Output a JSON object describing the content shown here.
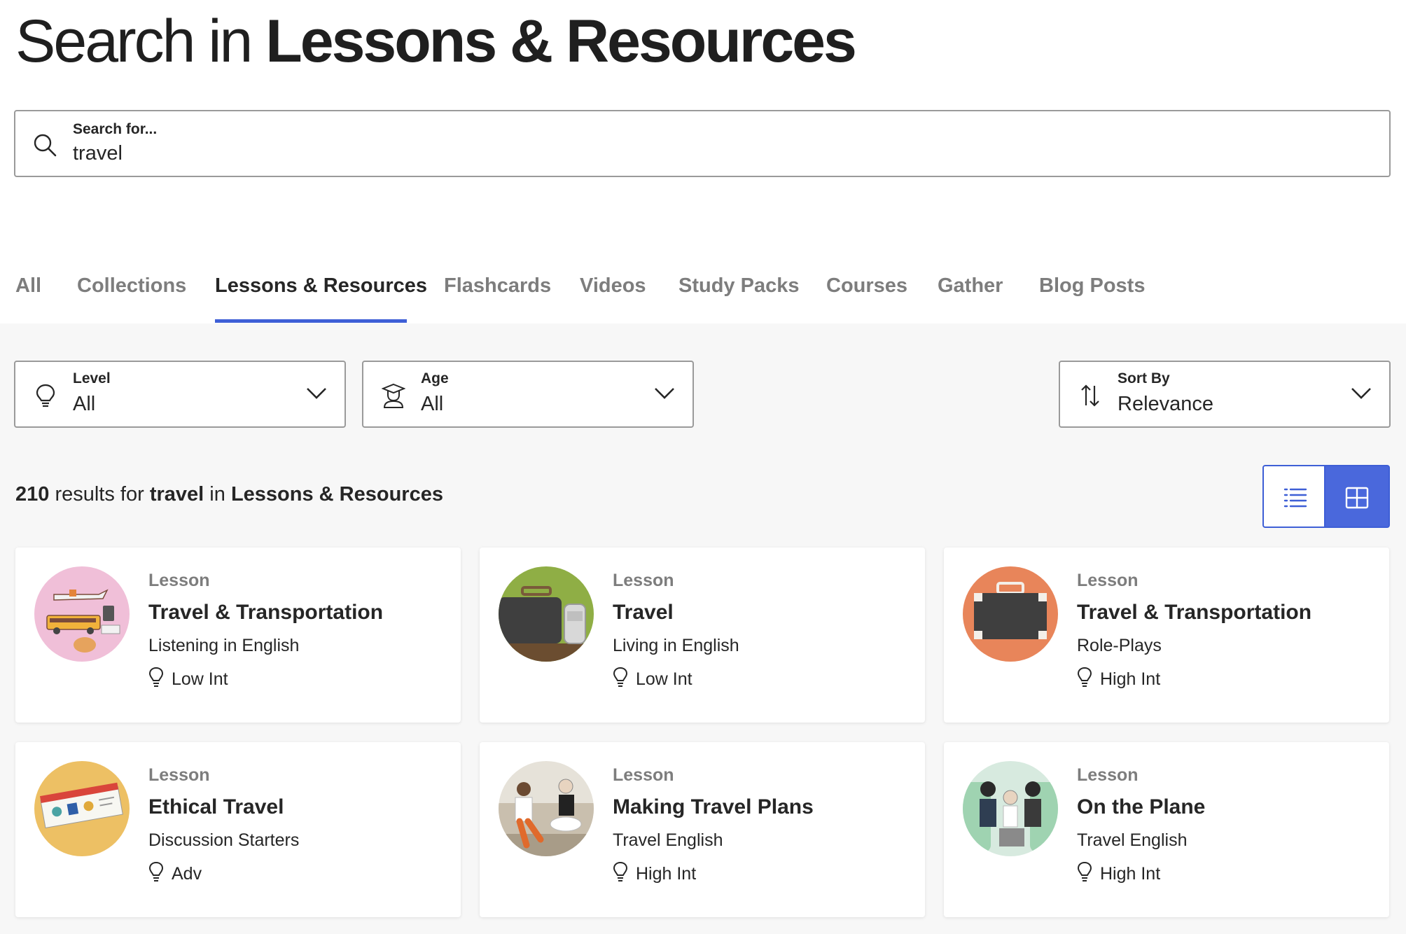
{
  "page_title": {
    "prefix": "Search in",
    "emphasis": "Lessons & Resources"
  },
  "search": {
    "label": "Search for...",
    "value": "travel",
    "icon": "search-icon"
  },
  "tabs": [
    {
      "label": "All",
      "active": false
    },
    {
      "label": "Collections",
      "active": false
    },
    {
      "label": "Lessons & Resources",
      "active": true
    },
    {
      "label": "Flashcards",
      "active": false
    },
    {
      "label": "Videos",
      "active": false
    },
    {
      "label": "Study Packs",
      "active": false
    },
    {
      "label": "Courses",
      "active": false
    },
    {
      "label": "Gather",
      "active": false
    },
    {
      "label": "Blog Posts",
      "active": false
    }
  ],
  "filters": {
    "level": {
      "label": "Level",
      "value": "All",
      "icon": "lightbulb-icon"
    },
    "age": {
      "label": "Age",
      "value": "All",
      "icon": "student-icon"
    },
    "sort": {
      "label": "Sort By",
      "value": "Relevance",
      "icon": "sort-arrows-icon"
    }
  },
  "results": {
    "count": "210",
    "text_results_for": "results for",
    "query": "travel",
    "text_in": "in",
    "section": "Lessons & Resources"
  },
  "view_toggle": {
    "active": "grid",
    "list_icon": "list-view-icon",
    "grid_icon": "grid-view-icon"
  },
  "colors": {
    "accent": "#3e5fd6",
    "accent_fill": "#4a68dc",
    "background": "#f7f7f7"
  },
  "cards": [
    {
      "type": "Lesson",
      "title": "Travel & Transportation",
      "subtitle": "Listening in English",
      "level": "Low Int",
      "thumb_bg": "#f0bfd8",
      "thumb": "vehicles-illustration"
    },
    {
      "type": "Lesson",
      "title": "Travel",
      "subtitle": "Living in English",
      "level": "Low Int",
      "thumb_bg": "#8fae45",
      "thumb": "suitcase-illustration"
    },
    {
      "type": "Lesson",
      "title": "Travel & Transportation",
      "subtitle": "Role-Plays",
      "level": "High Int",
      "thumb_bg": "#e8855a",
      "thumb": "suitcase-illustration"
    },
    {
      "type": "Lesson",
      "title": "Ethical Travel",
      "subtitle": "Discussion Starters",
      "level": "Adv",
      "thumb_bg": "#edc064",
      "thumb": "ticket-illustration"
    },
    {
      "type": "Lesson",
      "title": "Making Travel Plans",
      "subtitle": "Travel English",
      "level": "High Int",
      "thumb_bg": "#e6e2d9",
      "thumb": "people-on-sofa-illustration"
    },
    {
      "type": "Lesson",
      "title": "On the Plane",
      "subtitle": "Travel English",
      "level": "High Int",
      "thumb_bg": "#d7eadf",
      "thumb": "passengers-illustration"
    }
  ]
}
